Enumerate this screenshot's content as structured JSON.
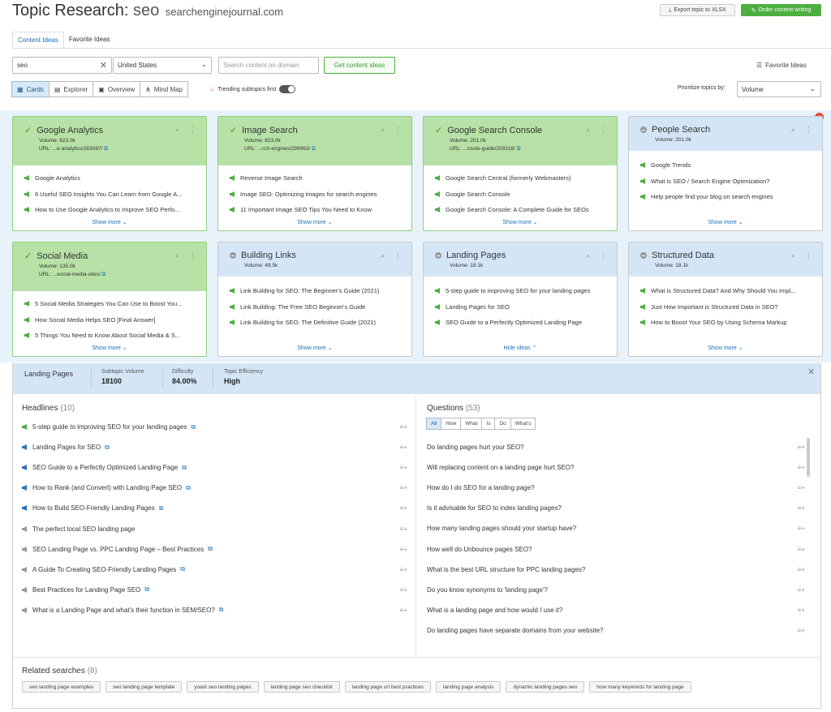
{
  "header": {
    "title_prefix": "Topic Research:",
    "keyword": "seo",
    "domain": "searchenginejournal.com",
    "export_label": "Export topic to XLSX",
    "order_label": "Order content writing"
  },
  "tabs": [
    "Content Ideas",
    "Favorite Ideas"
  ],
  "controls": {
    "search_value": "seo",
    "country": "United States",
    "domain_placeholder": "Search content on domain",
    "get_ideas_label": "Get content ideas",
    "favorite_ideas_label": "Favorite Ideas",
    "views": [
      "Cards",
      "Explorer",
      "Overview",
      "Mind Map"
    ],
    "trending_label": "Trending subtopics first",
    "prioritize_label": "Prioritize topics by:",
    "prioritize_value": "Volume"
  },
  "cards": [
    {
      "title": "Google Analytics",
      "volume": "Volume: 823.0k",
      "url": "URL: ...e-analytics/263087/",
      "items": [
        "Google Analytics",
        "6 Useful SEO Insights You Can Learn from Google A...",
        "How to Use Google Analytics to Improve SEO Perfo..."
      ],
      "more": "Show more"
    },
    {
      "title": "Image Search",
      "volume": "Volume: 823.0k",
      "url": "URL: ...rch-engines/299963/",
      "items": [
        "Reverse Image Search",
        "Image SEO: Optimizing images for search engines",
        "11 Important Image SEO Tips You Need to Know"
      ],
      "more": "Show more"
    },
    {
      "title": "Google Search Console",
      "volume": "Volume: 201.0k",
      "url": "URL: ...nsole-guide/209318/",
      "items": [
        "Google Search Central (formerly Webmasters)",
        "Google Search Console",
        "Google Search Console: A Complete Guide for SEOs"
      ],
      "more": "Show more"
    },
    {
      "title": "People Search",
      "volume": "Volume: 201.0k",
      "url": "",
      "items": [
        "Google Trends",
        "What is SEO / Search Engine Optimization?",
        "Help people find your blog on search engines"
      ],
      "more": "Show more"
    },
    {
      "title": "Social Media",
      "volume": "Volume: 135.0k",
      "url": "URL: ...social-media-sites/",
      "items": [
        "5 Social Media Strategies You Can Use to Boost You...",
        "How Social Media Helps SEO [Final Answer]",
        "5 Things You Need to Know About Social Media & S..."
      ],
      "more": "Show more"
    },
    {
      "title": "Building Links",
      "volume": "Volume: 49.5k",
      "url": "",
      "items": [
        "Link Building for SEO: The Beginner's Guide (2021)",
        "Link Building: The Free SEO Beginner's Guide",
        "Link Building for SEO: The Definitive Guide (2021)"
      ],
      "more": "Show more"
    },
    {
      "title": "Landing Pages",
      "volume": "Volume: 18.1k",
      "url": "",
      "items": [
        "5-step guide to improving SEO for your landing pages",
        "Landing Pages for SEO",
        "SEO Guide to a Perfectly Optimized Landing Page"
      ],
      "more": "Hide ideas"
    },
    {
      "title": "Structured Data",
      "volume": "Volume: 18.1k",
      "url": "",
      "items": [
        "What is Structured Data? And Why Should You Impl...",
        "Just How Important is Structured Data in SEO?",
        "How to Boost Your SEO by Using Schema Markup"
      ],
      "more": "Show more"
    }
  ],
  "detail": {
    "name": "Landing Pages",
    "stats": [
      {
        "label": "Subtopic Volume",
        "value": "18100"
      },
      {
        "label": "Difficulty",
        "value": "84.00%"
      },
      {
        "label": "Topic Efficiency",
        "value": "High"
      }
    ],
    "headlines_label": "Headlines",
    "headlines_count": "(10)",
    "headlines": [
      "5-step guide to improving SEO for your landing pages",
      "Landing Pages for SEO",
      "SEO Guide to a Perfectly Optimized Landing Page",
      "How to Rank (and Convert) with Landing Page SEO",
      "How to Build SEO-Friendly Landing Pages",
      "The perfect local SEO landing page",
      "SEO Landing Page vs. PPC Landing Page – Best Practices",
      "A Guide To Creating SEO-Friendly Landing Pages",
      "Best Practices for Landing Page SEO",
      "What is a Landing Page and what's their function in SEM/SEO?"
    ],
    "questions_label": "Questions",
    "questions_count": "(53)",
    "question_tabs": [
      "All",
      "How",
      "What",
      "Is",
      "Do",
      "What's"
    ],
    "questions": [
      "Do landing pages hurt your SEO?",
      "Will replacing content on a landing page hurt SEO?",
      "How do I do SEO for a landing page?",
      "Is it advisable for SEO to index landing pages?",
      "How many landing pages should your startup have?",
      "How well do Unbounce pages SEO?",
      "What is the best URL structure for PPC landing pages?",
      "Do you know synonyms to 'landing page'?",
      "What is a landing page and how would I use it?",
      "Do landing pages have separate domains from your website?"
    ],
    "related_label": "Related searches",
    "related_count": "(8)",
    "related": [
      "seo landing page examples",
      "seo landing page template",
      "yoast seo landing pages",
      "landing page seo checklist",
      "landing page url best practices",
      "landing page analysis",
      "dynamic landing pages seo",
      "how many keywords for landing page"
    ]
  },
  "colors": {
    "green": "#4caf3f",
    "blue_link": "#1a6fb5",
    "card_green_bg": "#b7e1a6",
    "card_blue_bg": "#d4e6f6"
  }
}
